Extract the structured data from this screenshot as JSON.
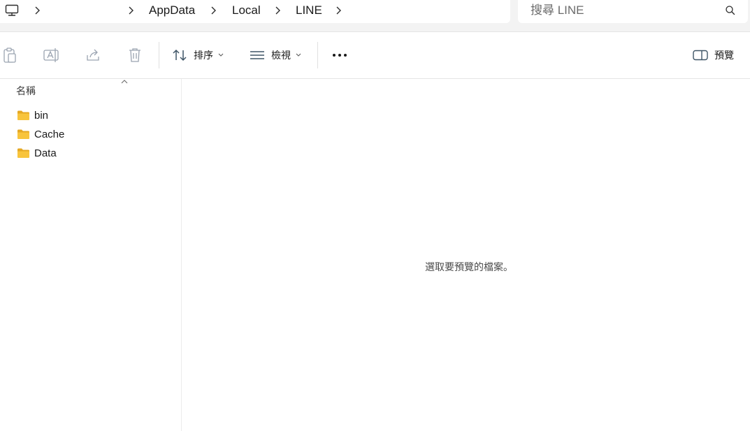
{
  "address_bar": {
    "breadcrumbs": [
      "AppData",
      "Local",
      "LINE"
    ],
    "pc_icon": "this-pc-icon"
  },
  "search": {
    "placeholder": "搜尋 LINE",
    "icon": "search-icon"
  },
  "toolbar": {
    "paste_icon": "paste-icon",
    "rename_icon": "rename-icon",
    "share_icon": "share-icon",
    "delete_icon": "trash-icon",
    "sort_label": "排序",
    "view_label": "檢視",
    "more_icon": "more-icon",
    "preview_label": "預覽"
  },
  "file_list": {
    "column_header": "名稱",
    "items": [
      {
        "name": "bin",
        "icon": "folder-icon"
      },
      {
        "name": "Cache",
        "icon": "folder-icon"
      },
      {
        "name": "Data",
        "icon": "folder-icon"
      }
    ]
  },
  "preview": {
    "message": "選取要預覽的檔案。"
  },
  "colors": {
    "folder": "#f8c43c",
    "folder_dark": "#e5a823",
    "disabled_icon": "#9aa3b0",
    "toolbar_icon": "#3f5566"
  }
}
